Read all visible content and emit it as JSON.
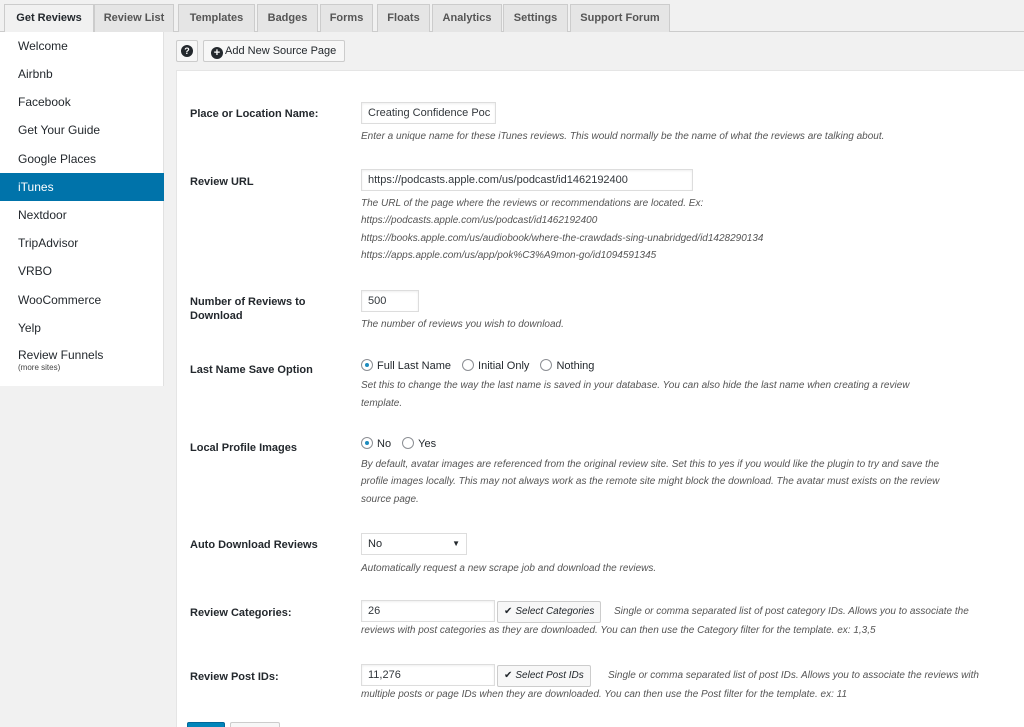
{
  "tabs": [
    "Get Reviews",
    "Review List",
    "Templates",
    "Badges",
    "Forms",
    "Floats",
    "Analytics",
    "Settings",
    "Support Forum"
  ],
  "sidebar": {
    "items": [
      "Welcome",
      "Airbnb",
      "Facebook",
      "Get Your Guide",
      "Google Places",
      "iTunes",
      "Nextdoor",
      "TripAdvisor",
      "VRBO",
      "WooCommerce",
      "Yelp"
    ],
    "funnels_label": "Review Funnels",
    "funnels_sub": "(more sites)",
    "active": "iTunes"
  },
  "toolbar": {
    "help_glyph": "?",
    "add_label": "Add New Source Page"
  },
  "form": {
    "place": {
      "label": "Place or Location Name:",
      "value": "Creating Confidence Poc",
      "desc": "Enter a unique name for these iTunes reviews. This would normally be the name of what the reviews are talking about."
    },
    "url": {
      "label": "Review URL",
      "value": "https://podcasts.apple.com/us/podcast/id1462192400",
      "desc1": "The URL of the page where the reviews or recommendations are located. Ex:",
      "desc2": "https://podcasts.apple.com/us/podcast/id1462192400",
      "desc3": "https://books.apple.com/us/audiobook/where-the-crawdads-sing-unabridged/id1428290134",
      "desc4": "https://apps.apple.com/us/app/pok%C3%A9mon-go/id1094591345"
    },
    "num": {
      "label1": "Number of Reviews to",
      "label2": "Download",
      "value": "500",
      "desc": "The number of reviews you wish to download."
    },
    "lastname": {
      "label": "Last Name Save Option",
      "options": [
        "Full Last Name",
        "Initial Only",
        "Nothing"
      ],
      "selected": "Full Last Name",
      "desc1": "Set this to change the way the last name is saved in your database. You can also hide the last name when creating a review",
      "desc2": "template."
    },
    "images": {
      "label": "Local Profile Images",
      "options": [
        "No",
        "Yes"
      ],
      "selected": "No",
      "desc1": "By default, avatar images are referenced from the original review site. Set this to yes if you would like the plugin to try and save the",
      "desc2": "profile images locally. This may not always work as the remote site might block the download. The avatar must exists on the review",
      "desc3": "source page."
    },
    "auto": {
      "label": "Auto Download Reviews",
      "value": "No",
      "caret": "▼",
      "desc": "Automatically request a new scrape job and download the reviews."
    },
    "categories": {
      "label": "Review Categories:",
      "value": "26",
      "button": "Select Categories",
      "desc1": "Single or comma separated list of post category IDs. Allows you to associate the",
      "desc2": "reviews with post categories as they are downloaded. You can then use the Category filter for the template. ex: 1,3,5"
    },
    "postids": {
      "label": "Review Post IDs:",
      "value": "11,276",
      "button": "Select Post IDs",
      "desc1": "Single or comma separated list of post IDs. Allows you to associate the reviews with",
      "desc2": "multiple posts or page IDs when they are downloaded. You can then use the Post filter for the template. ex: 11"
    },
    "check_glyph": "✔"
  },
  "colors": {
    "accent": "#0073aa",
    "background": "#f1f1f1",
    "panel": "#ffffff"
  }
}
